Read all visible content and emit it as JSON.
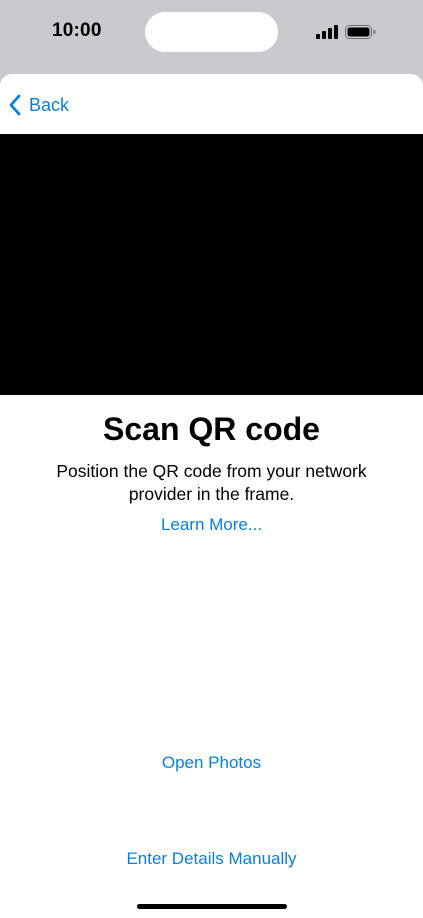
{
  "status_bar": {
    "time": "10:00",
    "icons": [
      "cellular-signal-icon",
      "battery-icon"
    ]
  },
  "nav": {
    "back_label": "Back",
    "back_icon": "chevron-left-icon"
  },
  "camera": {
    "state": "black-viewfinder"
  },
  "content": {
    "title": "Scan QR code",
    "subtitle": "Position the QR code from your network provider in the frame.",
    "learn_more": "Learn More..."
  },
  "actions": {
    "open_photos": "Open Photos",
    "enter_manually": "Enter Details Manually"
  },
  "colors": {
    "accent": "#0a7fd9",
    "background": "#ffffff",
    "outer": "#c9c9ce",
    "camera": "#000000"
  }
}
